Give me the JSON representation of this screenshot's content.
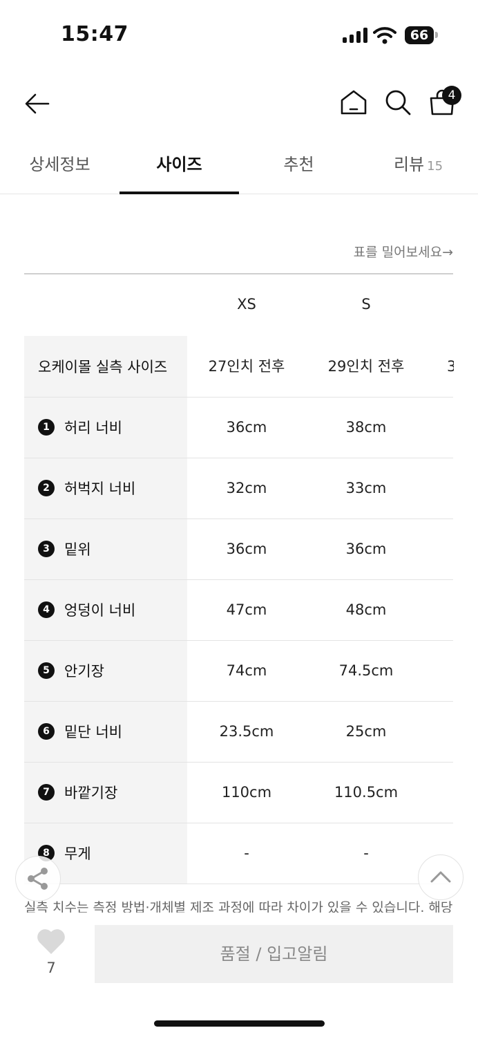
{
  "status_bar": {
    "time": "15:47",
    "battery": "66"
  },
  "nav": {
    "cart_count": "4"
  },
  "tabs": [
    {
      "label": "상세정보"
    },
    {
      "label": "사이즈"
    },
    {
      "label": "추천"
    },
    {
      "label": "리뷰",
      "count": "15"
    }
  ],
  "hint": "표를 밀어보세요→",
  "table": {
    "sizes": [
      "XS",
      "S"
    ],
    "header_row": {
      "label": "오케이몰 실측 사이즈",
      "values": [
        "27인치 전후",
        "29인치 전후",
        "3"
      ]
    },
    "rows": [
      {
        "num": "1",
        "label": "허리 너비",
        "values": [
          "36cm",
          "38cm"
        ]
      },
      {
        "num": "2",
        "label": "허벅지 너비",
        "values": [
          "32cm",
          "33cm"
        ]
      },
      {
        "num": "3",
        "label": "밑위",
        "values": [
          "36cm",
          "36cm"
        ]
      },
      {
        "num": "4",
        "label": "엉덩이 너비",
        "values": [
          "47cm",
          "48cm"
        ]
      },
      {
        "num": "5",
        "label": "안기장",
        "values": [
          "74cm",
          "74.5cm"
        ]
      },
      {
        "num": "6",
        "label": "밑단 너비",
        "values": [
          "23.5cm",
          "25cm"
        ]
      },
      {
        "num": "7",
        "label": "바깥기장",
        "values": [
          "110cm",
          "110.5cm"
        ]
      },
      {
        "num": "8",
        "label": "무게",
        "values": [
          "-",
          "-"
        ]
      }
    ]
  },
  "note": "실측 치수는 측정 방법·개체별 제조 과정에 따라 차이가 있을 수 있습니다. 해당",
  "bottom": {
    "like_count": "7",
    "action_label": "품절 / 입고알림"
  }
}
